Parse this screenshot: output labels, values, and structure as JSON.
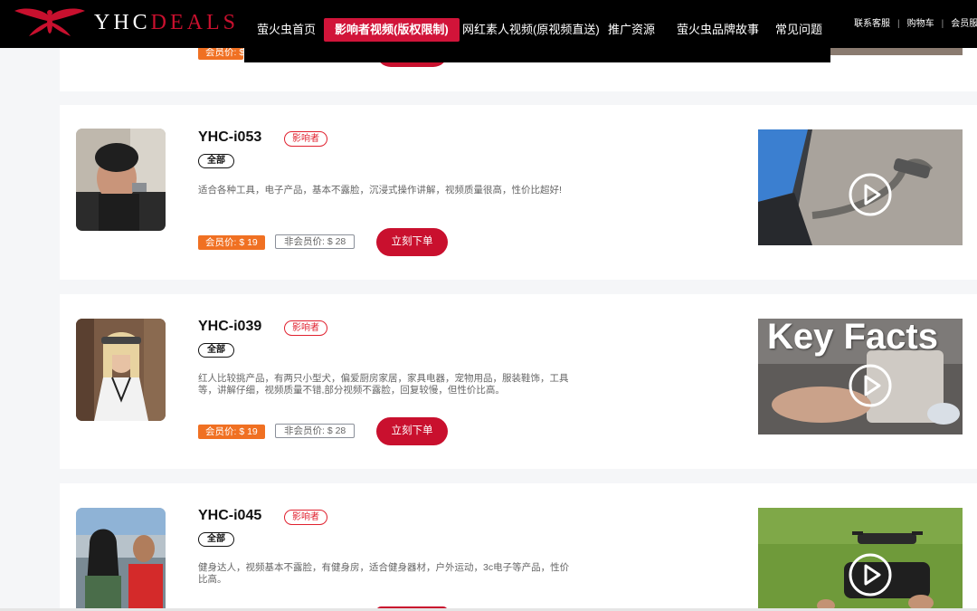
{
  "header": {
    "brand_white": "YHC",
    "brand_red": "DEALS",
    "nav": [
      {
        "label": "萤火虫首页"
      },
      {
        "label": "影响者视频(版权限制)",
        "active": true
      },
      {
        "label": "网红素人视频(原视频直送)"
      },
      {
        "label": "推广资源"
      },
      {
        "label": "萤火虫品牌故事"
      },
      {
        "label": "常见问题"
      }
    ],
    "links": [
      "联系客服",
      "购物车",
      "会员服务"
    ]
  },
  "prev_card": {
    "member_price_partial": "会员价: $"
  },
  "cards": [
    {
      "code": "YHC-i053",
      "tag": "影响者",
      "category": "全部",
      "desc": "适合各种工具，电子产品，基本不露脸，沉浸式操作讲解，视频质量很高，性价比超好!",
      "member_price": "会员价: $ 19",
      "non_member_price": "非会员价: $ 28",
      "order_label": "立刻下单"
    },
    {
      "code": "YHC-i039",
      "tag": "影响者",
      "category": "全部",
      "desc": "红人比较挑产品，有两只小型犬，偏爱厨房家居，家具电器，宠物用品，服装鞋饰，工具等，讲解仔细，视频质量不错,部分视频不露脸，回复较慢，但性价比高。",
      "member_price": "会员价: $ 19",
      "non_member_price": "非会员价: $ 28",
      "order_label": "立刻下单",
      "video_caption": "Key Facts"
    },
    {
      "code": "YHC-i045",
      "tag": "影响者",
      "category": "全部",
      "desc": "健身达人，视频基本不露脸，有健身房，适合健身器材，户外运动，3c电子等产品，性价比高。"
    }
  ],
  "colors": {
    "brand_red": "#c8102e",
    "nav_active": "#d11439",
    "member_orange": "#f07022",
    "order_button": "#c9102e",
    "tag_red": "#e0212f"
  }
}
